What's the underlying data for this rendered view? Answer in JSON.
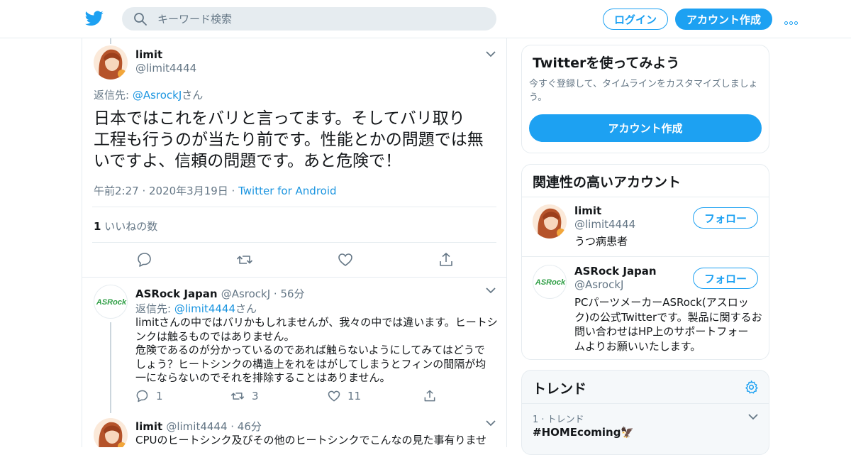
{
  "header": {
    "search_placeholder": "キーワード検索",
    "login_label": "ログイン",
    "signup_label": "アカウント作成"
  },
  "main_tweet": {
    "name": "limit",
    "handle": "@limit4444",
    "reply_prefix": "返信先: ",
    "reply_to": "@AsrockJ",
    "reply_suffix": "さん",
    "text_lines": [
      "日本ではこれをバリと言ってます。そしてバリ取り",
      "工程も行うのが当たり前です。性能とかの問題では無",
      "いですよ、信頼の問題です。あと危険で！"
    ],
    "time": "午前2:27 · 2020年3月19日 · ",
    "source": "Twitter for Android",
    "likes_count": "1",
    "likes_label": " いいねの数"
  },
  "reply1": {
    "name": "ASRock Japan",
    "handle": "@AsrockJ",
    "time": " · 56分",
    "reply_prefix": "返信先: ",
    "reply_to": "@limit4444",
    "reply_suffix": "さん",
    "text_lines": [
      "limitさんの中ではバリかもしれませんが、我々の中では違います。ヒートシ",
      "ンクは触るものではありません。",
      "危険であるのが分かっているのであれば触らないようにしてみてはどうで",
      "しょう？ヒートシンクの構造上をれをはがしてしまうとフィンの間隔が均",
      "一にならないのでそれを排除することはありません。"
    ],
    "reply_count": "1",
    "retweet_count": "3",
    "like_count": "11"
  },
  "reply2": {
    "name": "limit",
    "handle": "@limit4444",
    "time": " · 46分",
    "text": "CPUのヒートシンク及びその他のヒートシンクでこんなの見た事有りませ"
  },
  "signup_card": {
    "title": "Twitterを使ってみよう",
    "desc_lines": [
      "今すぐ登録して、タイムラインをカスタマイズしましょ",
      "う。"
    ],
    "button": "アカウント作成"
  },
  "related_card": {
    "title": "関連性の高いアカウント",
    "accounts": [
      {
        "name": "limit",
        "handle": "@limit4444",
        "bio_lines": [
          "うつ病患者"
        ],
        "follow": "フォロー"
      },
      {
        "name": "ASRock Japan",
        "handle": "@AsrockJ",
        "logo_text": "ASRock",
        "bio_lines": [
          "PCパーツメーカーASRock(アスロッ",
          "ク)の公式Twitterです。製品に関するお",
          "問い合わせはHP上のサポートフォー",
          "ムよりお願いいたします。"
        ],
        "follow": "フォロー"
      }
    ]
  },
  "trends_card": {
    "title": "トレンド",
    "items": [
      {
        "rank": "1 · トレンド",
        "name": "#HOMEcoming🦅"
      }
    ]
  },
  "colors": {
    "accent": "#1da1f2",
    "link": "#1b95e0",
    "muted": "#657786",
    "border": "#e6ecf0"
  }
}
